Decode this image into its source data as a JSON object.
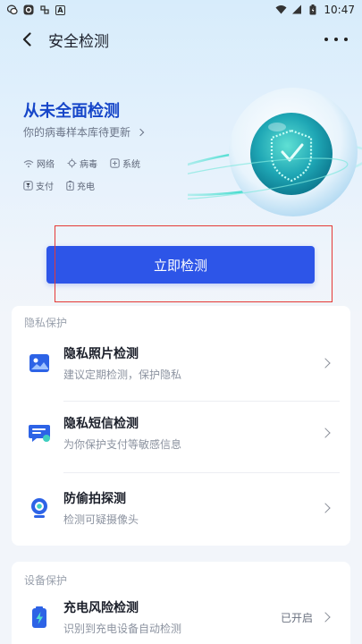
{
  "status_bar": {
    "time": "10:47",
    "left_icons": [
      "wechat-icon",
      "shield-app-icon",
      "hub-icon",
      "notification-a-icon"
    ],
    "right_icons": [
      "wifi-icon",
      "signal-icon",
      "battery-icon"
    ]
  },
  "header": {
    "title": "安全检测"
  },
  "hero": {
    "title": "从未全面检测",
    "subtitle": "你的病毒样本库待更新",
    "features_row1": [
      "网络",
      "病毒",
      "系统"
    ],
    "features_row2": [
      "支付",
      "充电"
    ]
  },
  "scan_button": {
    "label": "立即检测"
  },
  "privacy_section": {
    "label": "隐私保护",
    "items": [
      {
        "title": "隐私照片检测",
        "desc": "建议定期检测，保护隐私",
        "icon": "photo-icon"
      },
      {
        "title": "隐私短信检测",
        "desc": "为你保护支付等敏感信息",
        "icon": "sms-icon"
      },
      {
        "title": "防偷拍探测",
        "desc": "检测可疑摄像头",
        "icon": "camera-icon"
      }
    ]
  },
  "device_section": {
    "label": "设备保护",
    "items": [
      {
        "title": "充电风险检测",
        "desc": "识别到充电设备自动检测",
        "status": "已开启",
        "icon": "battery-charge-icon"
      }
    ]
  },
  "colors": {
    "accent": "#2d55e8",
    "hero_title": "#1646c9",
    "highlight": "#e53935"
  }
}
